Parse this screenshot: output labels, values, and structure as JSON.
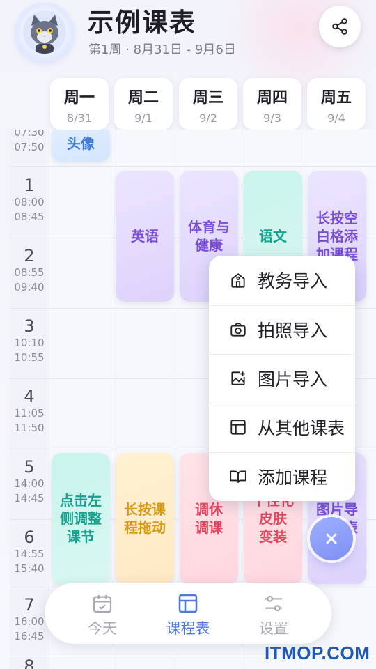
{
  "header": {
    "title": "示例课表",
    "week_range": "第1周 · 8月31日 - 9月6日"
  },
  "days": [
    {
      "name": "周一",
      "date": "8/31"
    },
    {
      "name": "周二",
      "date": "9/1"
    },
    {
      "name": "周三",
      "date": "9/2"
    },
    {
      "name": "周四",
      "date": "9/3"
    },
    {
      "name": "周五",
      "date": "9/4"
    }
  ],
  "periods": [
    {
      "num": "",
      "start": "07:30",
      "end": "07:50"
    },
    {
      "num": "1",
      "start": "08:00",
      "end": "08:45"
    },
    {
      "num": "2",
      "start": "08:55",
      "end": "09:40"
    },
    {
      "num": "3",
      "start": "10:10",
      "end": "10:55"
    },
    {
      "num": "4",
      "start": "11:05",
      "end": "11:50"
    },
    {
      "num": "5",
      "start": "14:00",
      "end": "14:45"
    },
    {
      "num": "6",
      "start": "14:55",
      "end": "15:40"
    },
    {
      "num": "7",
      "start": "16:00",
      "end": "16:45"
    },
    {
      "num": "8",
      "start": "",
      "end": ""
    }
  ],
  "courses": {
    "mon_top": "头像",
    "tue_1": "英语",
    "wed_1": "体育与\n健康",
    "thu_1": "语文",
    "fri_1": "长按空\n白格添\n加课程",
    "mon_5": "点击左\n侧调整\n课节",
    "tue_5": "长按课\n程拖动",
    "wed_5": "调休\n调课",
    "thu_5": "个性化\n皮肤\n变装",
    "fri_5": "图片导\n入课表"
  },
  "menu": {
    "items": [
      {
        "label": "教务导入",
        "icon": "school-icon"
      },
      {
        "label": "拍照导入",
        "icon": "camera-icon"
      },
      {
        "label": "图片导入",
        "icon": "image-add-icon"
      },
      {
        "label": "从其他课表",
        "icon": "table-icon"
      },
      {
        "label": "添加课程",
        "icon": "book-icon"
      }
    ]
  },
  "tabbar": {
    "today": "今天",
    "schedule": "课程表",
    "settings": "设置"
  },
  "watermark": "ITMOP.COM",
  "colors": {
    "accent": "#4f78d9",
    "purple": "#7a4fd6",
    "teal": "#13a28e",
    "yellow": "#d89a17",
    "pink": "#e2485e"
  }
}
